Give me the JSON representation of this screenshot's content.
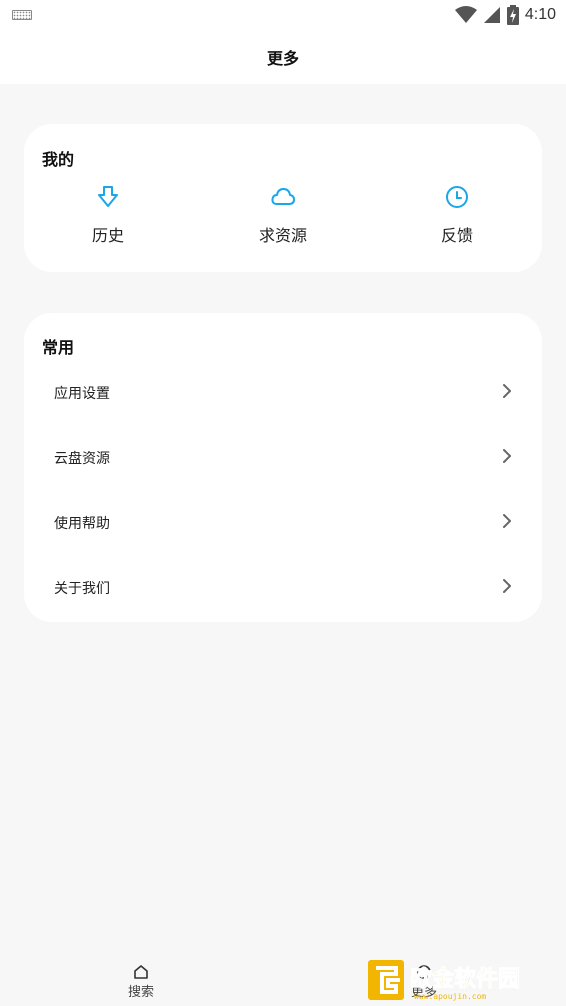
{
  "status_bar": {
    "time": "4:10",
    "icons": [
      "keyboard-icon",
      "wifi-icon",
      "signal-icon",
      "battery-charging-icon"
    ]
  },
  "header": {
    "title": "更多"
  },
  "mine": {
    "title": "我的",
    "items": [
      {
        "label": "历史",
        "icon": "download-icon"
      },
      {
        "label": "求资源",
        "icon": "cloud-icon"
      },
      {
        "label": "反馈",
        "icon": "clock-icon"
      }
    ],
    "accent": "#1aa7e8"
  },
  "common": {
    "title": "常用",
    "items": [
      {
        "label": "应用设置"
      },
      {
        "label": "云盘资源"
      },
      {
        "label": "使用帮助"
      },
      {
        "label": "关于我们"
      }
    ]
  },
  "tabbar": {
    "items": [
      {
        "label": "搜索",
        "icon": "home-icon"
      },
      {
        "label": "更多",
        "icon": "more-icon"
      }
    ]
  },
  "watermark": {
    "text": "欧金软件园",
    "url": "www.apoujin.com"
  }
}
